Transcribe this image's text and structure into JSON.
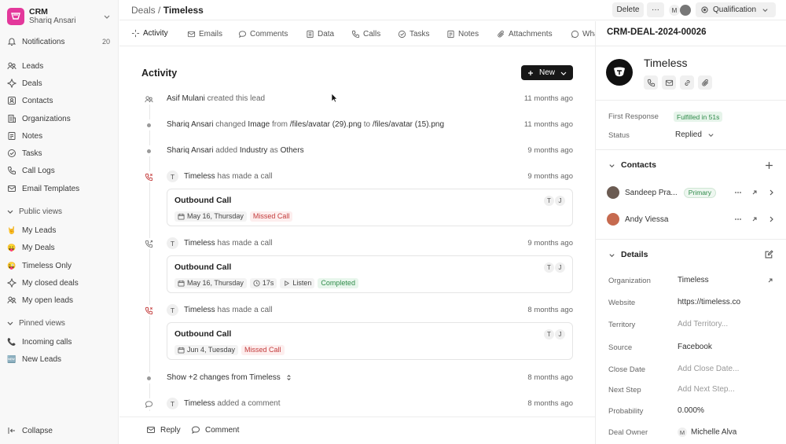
{
  "sidebar": {
    "app_name": "CRM",
    "user_name": "Shariq Ansari",
    "notifications": {
      "label": "Notifications",
      "count": "20"
    },
    "nav": [
      {
        "label": "Leads",
        "icon": "leads-icon"
      },
      {
        "label": "Deals",
        "icon": "deals-icon"
      },
      {
        "label": "Contacts",
        "icon": "contacts-icon"
      },
      {
        "label": "Organizations",
        "icon": "organizations-icon"
      },
      {
        "label": "Notes",
        "icon": "notes-icon"
      },
      {
        "label": "Tasks",
        "icon": "tasks-icon"
      },
      {
        "label": "Call Logs",
        "icon": "phone-icon"
      },
      {
        "label": "Email Templates",
        "icon": "email-icon"
      }
    ],
    "public_views_label": "Public views",
    "public_views": [
      {
        "emoji": "🤘",
        "label": "My Leads"
      },
      {
        "emoji": "😛",
        "label": "My Deals"
      },
      {
        "emoji": "😜",
        "label": "Timeless Only"
      },
      {
        "label": "My closed deals",
        "icon": "deals-icon"
      },
      {
        "label": "My open leads",
        "icon": "leads-icon"
      }
    ],
    "pinned_views_label": "Pinned views",
    "pinned_views": [
      {
        "emoji": "📞",
        "label": "Incoming calls"
      },
      {
        "emoji": "🆕",
        "label": "New Leads"
      }
    ],
    "collapse_label": "Collapse"
  },
  "header": {
    "breadcrumb_parent": "Deals",
    "breadcrumb_sep": " / ",
    "breadcrumb_current": "Timeless",
    "delete_label": "Delete",
    "more_label": "···",
    "avatar_initial": "M",
    "status_label": "Qualification"
  },
  "tabs": [
    {
      "label": "Activity",
      "icon": "activity-icon",
      "active": true
    },
    {
      "label": "Emails",
      "icon": "email-icon"
    },
    {
      "label": "Comments",
      "icon": "comment-icon"
    },
    {
      "label": "Data",
      "icon": "data-icon"
    },
    {
      "label": "Calls",
      "icon": "phone-icon"
    },
    {
      "label": "Tasks",
      "icon": "tasks-icon"
    },
    {
      "label": "Notes",
      "icon": "notes-icon"
    },
    {
      "label": "Attachments",
      "icon": "attachment-icon"
    },
    {
      "label": "WhatsApp",
      "icon": "whatsapp-icon"
    }
  ],
  "activity": {
    "title": "Activity",
    "new_label": "New",
    "items": [
      {
        "actor": "Asif Mulani",
        "text": " created this lead",
        "time": "11 months ago"
      },
      {
        "actor": "Shariq Ansari",
        "text": " changed ",
        "field": "Image",
        "from_text": " from ",
        "from_val": "/files/avatar (29).png",
        "to_text": " to ",
        "to_val": "/files/avatar (15).png",
        "time": "11 months ago"
      },
      {
        "actor": "Shariq Ansari",
        "text": " added ",
        "field": "Industry",
        "as_text": " as ",
        "value": "Others",
        "time": "9 months ago"
      },
      {
        "avatar": "T",
        "actor": "Timeless",
        "text": " has made a call",
        "time": "9 months ago",
        "card": {
          "title": "Outbound Call",
          "date": "May 16, Thursday",
          "status": "Missed Call",
          "avatars": [
            "T",
            "J"
          ]
        }
      },
      {
        "avatar": "T",
        "actor": "Timeless",
        "text": " has made a call",
        "time": "9 months ago",
        "card": {
          "title": "Outbound Call",
          "date": "May 16, Thursday",
          "duration": "17s",
          "listen": "Listen",
          "status": "Completed",
          "avatars": [
            "T",
            "J"
          ]
        }
      },
      {
        "avatar": "T",
        "actor": "Timeless",
        "text": " has made a call",
        "time": "8 months ago",
        "card": {
          "title": "Outbound Call",
          "date": "Jun 4, Tuesday",
          "status": "Missed Call",
          "avatars": [
            "T",
            "J"
          ]
        }
      },
      {
        "show_text": "Show +2 changes from Timeless",
        "time": "8 months ago"
      },
      {
        "avatar": "T",
        "actor": "Timeless",
        "text": " added a comment",
        "time": "8 months ago"
      }
    ]
  },
  "footer": {
    "reply_label": "Reply",
    "comment_label": "Comment"
  },
  "right_panel": {
    "deal_id": "CRM-DEAL-2024-00026",
    "org_name": "Timeless",
    "first_response_label": "First Response",
    "first_response_value": "Fulfilled in 51s",
    "status_label": "Status",
    "status_value": "Replied",
    "contacts_title": "Contacts",
    "contacts": [
      {
        "name": "Sandeep Pra...",
        "badge": "Primary"
      },
      {
        "name": "Andy Viessa"
      }
    ],
    "details_title": "Details",
    "details": [
      {
        "label": "Organization",
        "value": "Timeless"
      },
      {
        "label": "Website",
        "value": "https://timeless.co"
      },
      {
        "label": "Territory",
        "placeholder": "Add Territory..."
      },
      {
        "label": "Source",
        "value": "Facebook"
      },
      {
        "label": "Close Date",
        "placeholder": "Add Close Date..."
      },
      {
        "label": "Next Step",
        "placeholder": "Add Next Step..."
      },
      {
        "label": "Probability",
        "value": "0.000%"
      },
      {
        "label": "Deal Owner",
        "avatar": "M",
        "value": "Michelle Alva"
      }
    ]
  },
  "colors": {
    "brand": "#e3389b",
    "primary_button": "#171717",
    "missed": "#c33b3b",
    "completed": "#2f8b4a"
  }
}
